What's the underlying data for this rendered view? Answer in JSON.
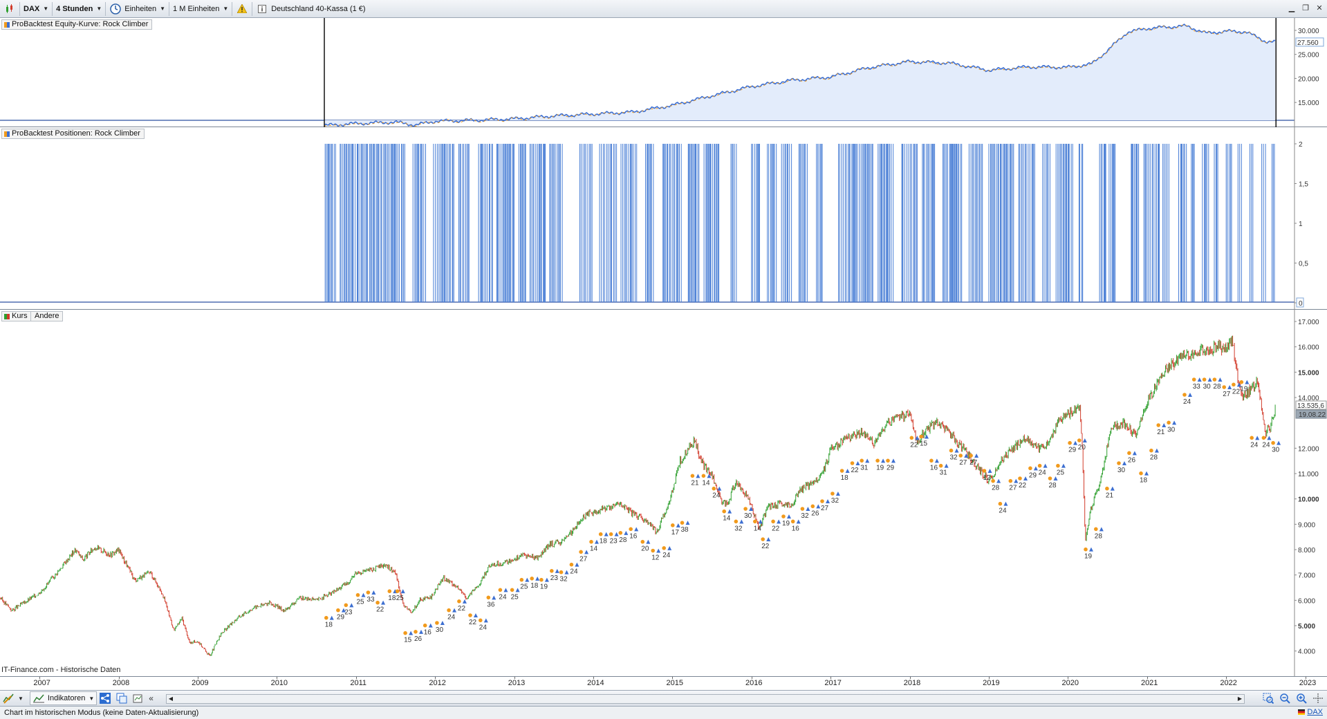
{
  "toolbar": {
    "symbol": "DAX",
    "timeframe": "4 Stunden",
    "units_label": "Einheiten",
    "units_count": "1 M Einheiten",
    "instrument": "Deutschland 40-Kassa (1 €)"
  },
  "equity_panel": {
    "title": "ProBacktest Equity-Kurve: Rock Climber",
    "y_ticks": [
      "30.000",
      "25.000",
      "20.000",
      "15.000"
    ],
    "current_value": "27.560",
    "fill_color": "#e3ecfb",
    "line_colors": [
      "#3d6fd1",
      "#f19a1c"
    ]
  },
  "positions_panel": {
    "title": "ProBacktest Positionen: Rock Climber",
    "y_ticks": [
      "2",
      "1,5",
      "1",
      "0,5",
      "0"
    ],
    "bar_color": "#4a7fd6"
  },
  "price_panel": {
    "tag_kurs": "Kurs",
    "tag_andere": "Andere",
    "y_ticks": [
      "17.000",
      "16.000",
      "15.000",
      "14.000",
      "12.000",
      "11.000",
      "10.000",
      "9.000",
      "8.000",
      "7.000",
      "6.000",
      "5.000",
      "4.000"
    ],
    "bold_ticks": [
      "15.000",
      "10.000",
      "5.000"
    ],
    "current_price": "13.535,6",
    "current_date": "19.08.22",
    "source": "IT-Finance.com - Historische Daten",
    "trade_labels": [
      {
        "year": 2010.65,
        "price": 5200,
        "n": "18"
      },
      {
        "year": 2010.8,
        "price": 5500,
        "n": "29"
      },
      {
        "year": 2010.9,
        "price": 5700,
        "n": "23"
      },
      {
        "year": 2011.05,
        "price": 6100,
        "n": "25"
      },
      {
        "year": 2011.18,
        "price": 6200,
        "n": "33"
      },
      {
        "year": 2011.3,
        "price": 5800,
        "n": "22"
      },
      {
        "year": 2011.45,
        "price": 6250,
        "n": "18"
      },
      {
        "year": 2011.55,
        "price": 6250,
        "n": "25"
      },
      {
        "year": 2011.65,
        "price": 4600,
        "n": "15"
      },
      {
        "year": 2011.78,
        "price": 4650,
        "n": "26"
      },
      {
        "year": 2011.9,
        "price": 4900,
        "n": "16"
      },
      {
        "year": 2012.05,
        "price": 5000,
        "n": "30"
      },
      {
        "year": 2012.2,
        "price": 5500,
        "n": "24"
      },
      {
        "year": 2012.33,
        "price": 5850,
        "n": "22"
      },
      {
        "year": 2012.47,
        "price": 5300,
        "n": "22"
      },
      {
        "year": 2012.6,
        "price": 5100,
        "n": "24"
      },
      {
        "year": 2012.7,
        "price": 6000,
        "n": "36"
      },
      {
        "year": 2012.85,
        "price": 6300,
        "n": "24"
      },
      {
        "year": 2013.0,
        "price": 6300,
        "n": "25"
      },
      {
        "year": 2013.12,
        "price": 6700,
        "n": "25"
      },
      {
        "year": 2013.25,
        "price": 6750,
        "n": "18"
      },
      {
        "year": 2013.37,
        "price": 6700,
        "n": "19"
      },
      {
        "year": 2013.5,
        "price": 7050,
        "n": "23"
      },
      {
        "year": 2013.62,
        "price": 7000,
        "n": "32"
      },
      {
        "year": 2013.75,
        "price": 7300,
        "n": "24"
      },
      {
        "year": 2013.87,
        "price": 7800,
        "n": "27"
      },
      {
        "year": 2014.0,
        "price": 8200,
        "n": "14"
      },
      {
        "year": 2014.12,
        "price": 8500,
        "n": "18"
      },
      {
        "year": 2014.25,
        "price": 8500,
        "n": "23"
      },
      {
        "year": 2014.37,
        "price": 8550,
        "n": "28"
      },
      {
        "year": 2014.5,
        "price": 8700,
        "n": "16"
      },
      {
        "year": 2014.65,
        "price": 8200,
        "n": "20"
      },
      {
        "year": 2014.78,
        "price": 7850,
        "n": "12"
      },
      {
        "year": 2014.92,
        "price": 7950,
        "n": "24"
      },
      {
        "year": 2015.03,
        "price": 8850,
        "n": "17"
      },
      {
        "year": 2015.15,
        "price": 8950,
        "n": "38"
      },
      {
        "year": 2015.28,
        "price": 10800,
        "n": "21"
      },
      {
        "year": 2015.42,
        "price": 10800,
        "n": "14"
      },
      {
        "year": 2015.55,
        "price": 10300,
        "n": "24"
      },
      {
        "year": 2015.68,
        "price": 9400,
        "n": "14"
      },
      {
        "year": 2015.83,
        "price": 9000,
        "n": "32"
      },
      {
        "year": 2015.95,
        "price": 9500,
        "n": "30"
      },
      {
        "year": 2016.07,
        "price": 9000,
        "n": "14"
      },
      {
        "year": 2016.17,
        "price": 8300,
        "n": "22"
      },
      {
        "year": 2016.3,
        "price": 9000,
        "n": "22"
      },
      {
        "year": 2016.43,
        "price": 9200,
        "n": "19"
      },
      {
        "year": 2016.55,
        "price": 9000,
        "n": "16"
      },
      {
        "year": 2016.67,
        "price": 9500,
        "n": "32"
      },
      {
        "year": 2016.8,
        "price": 9600,
        "n": "26"
      },
      {
        "year": 2016.92,
        "price": 9800,
        "n": "27"
      },
      {
        "year": 2017.05,
        "price": 10100,
        "n": "32"
      },
      {
        "year": 2017.17,
        "price": 11000,
        "n": "18"
      },
      {
        "year": 2017.3,
        "price": 11300,
        "n": "22"
      },
      {
        "year": 2017.42,
        "price": 11400,
        "n": "31"
      },
      {
        "year": 2017.62,
        "price": 11400,
        "n": "19"
      },
      {
        "year": 2017.75,
        "price": 11400,
        "n": "29"
      },
      {
        "year": 2018.05,
        "price": 12300,
        "n": "22"
      },
      {
        "year": 2018.17,
        "price": 12350,
        "n": "15"
      },
      {
        "year": 2018.3,
        "price": 11400,
        "n": "16"
      },
      {
        "year": 2018.42,
        "price": 11200,
        "n": "31"
      },
      {
        "year": 2018.55,
        "price": 11800,
        "n": "32"
      },
      {
        "year": 2018.67,
        "price": 11600,
        "n": "27"
      },
      {
        "year": 2018.8,
        "price": 11600,
        "n": "27"
      },
      {
        "year": 2018.97,
        "price": 11000,
        "n": "12"
      },
      {
        "year": 2019.08,
        "price": 10600,
        "n": "28"
      },
      {
        "year": 2019.17,
        "price": 9700,
        "n": "24"
      },
      {
        "year": 2019.3,
        "price": 10600,
        "n": "27"
      },
      {
        "year": 2019.42,
        "price": 10700,
        "n": "22"
      },
      {
        "year": 2019.55,
        "price": 11100,
        "n": "29"
      },
      {
        "year": 2019.67,
        "price": 11200,
        "n": "24"
      },
      {
        "year": 2019.8,
        "price": 10700,
        "n": "28"
      },
      {
        "year": 2019.9,
        "price": 11200,
        "n": "25"
      },
      {
        "year": 2020.05,
        "price": 12100,
        "n": "29"
      },
      {
        "year": 2020.17,
        "price": 12200,
        "n": "20"
      },
      {
        "year": 2020.25,
        "price": 7900,
        "n": "19"
      },
      {
        "year": 2020.38,
        "price": 8700,
        "n": "28"
      },
      {
        "year": 2020.52,
        "price": 10300,
        "n": "21"
      },
      {
        "year": 2020.67,
        "price": 11300,
        "n": "30"
      },
      {
        "year": 2020.8,
        "price": 11700,
        "n": "26"
      },
      {
        "year": 2020.95,
        "price": 10900,
        "n": "18"
      },
      {
        "year": 2021.08,
        "price": 11800,
        "n": "28"
      },
      {
        "year": 2021.17,
        "price": 12800,
        "n": "21"
      },
      {
        "year": 2021.3,
        "price": 12900,
        "n": "30"
      },
      {
        "year": 2021.5,
        "price": 14000,
        "n": "24"
      },
      {
        "year": 2021.62,
        "price": 14600,
        "n": "33"
      },
      {
        "year": 2021.75,
        "price": 14600,
        "n": "30"
      },
      {
        "year": 2021.88,
        "price": 14600,
        "n": "28"
      },
      {
        "year": 2022.0,
        "price": 14300,
        "n": "27"
      },
      {
        "year": 2022.12,
        "price": 14400,
        "n": "22"
      },
      {
        "year": 2022.22,
        "price": 14500,
        "n": "19"
      },
      {
        "year": 2022.35,
        "price": 12300,
        "n": "24"
      },
      {
        "year": 2022.5,
        "price": 12300,
        "n": "24"
      },
      {
        "year": 2022.62,
        "price": 12100,
        "n": "30"
      }
    ]
  },
  "x_axis": {
    "labels": [
      "2007",
      "2008",
      "2009",
      "2010",
      "2011",
      "2012",
      "2013",
      "2014",
      "2015",
      "2016",
      "2017",
      "2018",
      "2019",
      "2020",
      "2021",
      "2022",
      "2023"
    ]
  },
  "bottom_toolbar": {
    "indicators_label": "Indikatoren"
  },
  "status": {
    "text": "Chart im historischen Modus (keine Daten-Aktualisierung)",
    "link": "DAX"
  },
  "chart_data": [
    {
      "type": "area",
      "title": "ProBacktest Equity-Kurve: Rock Climber",
      "x": [
        2010.6,
        2011.0,
        2011.5,
        2011.75,
        2012.0,
        2012.5,
        2013.0,
        2013.5,
        2014.0,
        2014.5,
        2015.0,
        2015.5,
        2016.0,
        2016.5,
        2017.0,
        2017.5,
        2018.0,
        2018.5,
        2019.0,
        2019.5,
        2020.0,
        2020.3,
        2020.5,
        2020.75,
        2021.0,
        2021.25,
        2021.5,
        2021.75,
        2022.0,
        2022.25,
        2022.5,
        2022.62
      ],
      "values": [
        10200,
        10600,
        10900,
        10300,
        11100,
        11300,
        11600,
        12200,
        12600,
        13000,
        14400,
        16400,
        18300,
        19600,
        20300,
        22300,
        23500,
        23200,
        21700,
        22400,
        22300,
        23000,
        25800,
        29600,
        30400,
        30700,
        30900,
        29400,
        29800,
        29700,
        27700,
        27560
      ],
      "ylim": [
        11000,
        32000
      ],
      "y_ticks": [
        15000,
        20000,
        25000,
        30000
      ],
      "grid": false
    },
    {
      "type": "bar",
      "title": "ProBacktest Positionen: Rock Climber",
      "ylim": [
        0,
        2
      ],
      "position_value": 2,
      "active_intervals": [
        [
          2010.61,
          2010.75
        ],
        [
          2010.8,
          2011.62
        ],
        [
          2011.72,
          2011.9
        ],
        [
          2011.98,
          2012.24
        ],
        [
          2012.3,
          2012.45
        ],
        [
          2012.55,
          2012.73
        ],
        [
          2012.78,
          2013.0
        ],
        [
          2013.06,
          2013.15
        ],
        [
          2013.2,
          2013.4
        ],
        [
          2013.45,
          2013.62
        ],
        [
          2013.83,
          2014.0
        ],
        [
          2014.08,
          2014.3
        ],
        [
          2014.35,
          2014.55
        ],
        [
          2014.66,
          2014.76
        ],
        [
          2014.88,
          2015.12
        ],
        [
          2015.2,
          2015.34
        ],
        [
          2015.4,
          2015.6
        ],
        [
          2015.74,
          2015.82
        ],
        [
          2016.0,
          2016.12
        ],
        [
          2016.2,
          2016.32
        ],
        [
          2016.38,
          2016.52
        ],
        [
          2016.6,
          2016.72
        ],
        [
          2016.82,
          2016.9
        ],
        [
          2017.1,
          2017.55
        ],
        [
          2017.6,
          2017.8
        ],
        [
          2017.9,
          2018.1
        ],
        [
          2018.16,
          2018.32
        ],
        [
          2018.42,
          2018.66
        ],
        [
          2018.75,
          2018.92
        ],
        [
          2019.0,
          2019.32
        ],
        [
          2019.38,
          2019.6
        ],
        [
          2019.68,
          2019.78
        ],
        [
          2019.85,
          2020.07
        ],
        [
          2020.14,
          2020.2
        ],
        [
          2020.4,
          2020.48
        ],
        [
          2020.52,
          2020.62
        ],
        [
          2020.8,
          2020.9
        ],
        [
          2020.96,
          2021.16
        ],
        [
          2021.2,
          2021.3
        ],
        [
          2021.4,
          2021.5
        ],
        [
          2021.56,
          2021.62
        ],
        [
          2021.7,
          2021.8
        ],
        [
          2021.85,
          2021.9
        ],
        [
          2022.0,
          2022.08
        ],
        [
          2022.15,
          2022.2
        ],
        [
          2022.3,
          2022.34
        ],
        [
          2022.45,
          2022.5
        ],
        [
          2022.58,
          2022.62
        ]
      ],
      "grid": false
    },
    {
      "type": "line",
      "title": "Kurs",
      "x": [
        2006.5,
        2006.65,
        2006.8,
        2007.0,
        2007.2,
        2007.45,
        2007.55,
        2007.7,
        2007.9,
        2008.0,
        2008.2,
        2008.4,
        2008.55,
        2008.7,
        2008.8,
        2008.9,
        2009.0,
        2009.15,
        2009.3,
        2009.5,
        2009.7,
        2009.9,
        2010.1,
        2010.3,
        2010.5,
        2010.7,
        2010.9,
        2011.0,
        2011.2,
        2011.35,
        2011.5,
        2011.6,
        2011.7,
        2011.8,
        2011.95,
        2012.1,
        2012.25,
        2012.4,
        2012.55,
        2012.7,
        2012.9,
        2013.1,
        2013.3,
        2013.45,
        2013.6,
        2013.75,
        2013.9,
        2014.05,
        2014.2,
        2014.35,
        2014.5,
        2014.65,
        2014.8,
        2014.95,
        2015.1,
        2015.27,
        2015.4,
        2015.5,
        2015.6,
        2015.7,
        2015.8,
        2015.95,
        2016.1,
        2016.2,
        2016.35,
        2016.5,
        2016.6,
        2016.75,
        2016.9,
        2017.0,
        2017.2,
        2017.4,
        2017.55,
        2017.7,
        2017.85,
        2018.0,
        2018.1,
        2018.2,
        2018.35,
        2018.5,
        2018.65,
        2018.8,
        2018.95,
        2019.0,
        2019.15,
        2019.3,
        2019.45,
        2019.6,
        2019.75,
        2019.9,
        2020.05,
        2020.15,
        2020.18,
        2020.22,
        2020.28,
        2020.4,
        2020.55,
        2020.7,
        2020.85,
        2021.0,
        2021.15,
        2021.3,
        2021.45,
        2021.6,
        2021.75,
        2021.9,
        2022.0,
        2022.08,
        2022.12,
        2022.2,
        2022.3,
        2022.4,
        2022.5,
        2022.55,
        2022.62
      ],
      "values": [
        6100,
        5600,
        5900,
        6300,
        7000,
        8000,
        7600,
        8100,
        7800,
        8000,
        6800,
        7100,
        6300,
        4800,
        5300,
        4300,
        4400,
        3800,
        4700,
        5300,
        5700,
        5900,
        5600,
        6100,
        6000,
        6300,
        6700,
        7100,
        7200,
        7400,
        7100,
        5800,
        5500,
        6000,
        6100,
        6900,
        6600,
        6100,
        6600,
        7400,
        7500,
        7800,
        7700,
        8200,
        8300,
        8800,
        9400,
        9500,
        9700,
        9800,
        9400,
        9200,
        8700,
        9800,
        11500,
        12300,
        11300,
        11000,
        10000,
        9800,
        10700,
        10100,
        8800,
        9700,
        9800,
        9700,
        10300,
        10600,
        11000,
        11900,
        12400,
        12600,
        12200,
        12900,
        13200,
        13400,
        12200,
        12700,
        13000,
        12600,
        12100,
        11500,
        10900,
        10700,
        11500,
        12000,
        12400,
        12000,
        12200,
        13200,
        13400,
        13700,
        12000,
        8400,
        9500,
        10600,
        12800,
        13000,
        12500,
        13800,
        14700,
        15300,
        15600,
        15800,
        15900,
        16000,
        15900,
        16300,
        15200,
        14000,
        14300,
        14600,
        12600,
        12800,
        13535.6
      ],
      "ylim": [
        3500,
        17300
      ],
      "y_ticks": [
        4000,
        5000,
        6000,
        7000,
        8000,
        9000,
        10000,
        11000,
        12000,
        13000,
        14000,
        15000,
        16000,
        17000
      ],
      "grid": false
    }
  ]
}
